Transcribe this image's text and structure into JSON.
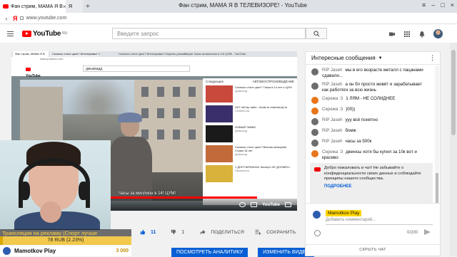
{
  "browser": {
    "tabs": [
      {
        "label": "Фан стрим, МАМА Я В"
      },
      {
        "label": "Я"
      }
    ],
    "window_title": "Фан стрим, МАМА Я В ТЕЛЕВИЗОРЕ! - YouTube",
    "url": "www.youtube.com"
  },
  "header": {
    "logo_text": "YouTube",
    "logo_region": "RU",
    "search_placeholder": "Введите запрос",
    "icons": [
      "video-camera-icon",
      "apps-grid-icon",
      "bell-icon",
      "avatar"
    ]
  },
  "embedded_stream": {
    "inner_tabs": [
      "Фан стрим, МАМА Я В",
      "Сколько стоит цикл? Инстаграмы! Секреты..."
    ],
    "inner_url": "www.youtube.com",
    "inner_title": "Сколько стоит цикл? Инстаграмы! Секреты раскайверат Часы за миллион в 14! ЦУМ! - YouTube",
    "inner_search": "дмыквадд",
    "next_label": "Следующее",
    "autoplay_label": "АВТОВОСПРОИЗВЕДЕНИЕ",
    "caption": "Часы за миллион в 14! ЦУМ!",
    "suggestions": [
      {
        "title": "Сколько стоит цикл? Тачка в 14 лет и ЦУМ",
        "meta": "Дымоход",
        "thumb": "#c9493c"
      },
      {
        "title": "24/7 lofi hip radio - beats to relax/study to",
        "meta": "ChilledCow",
        "thumb": "#3a2f6a"
      },
      {
        "title": "НОВЫЙ ЛИМИ!",
        "meta": "Дымоход",
        "thumb": "#1a1a1a"
      },
      {
        "title": "Сколько стоит цикл? Вечная женщина! Стрим 16 лет",
        "meta": "Дымоход",
        "thumb": "#c26a3a"
      },
      {
        "title": "1 ДНЯ ПАРКИНАЧ Эксперт НЕ ДОЛЖЕН...",
        "meta": "Прокатило",
        "thumb": "#d8b23a"
      }
    ],
    "progress": 0.86,
    "brand": "YouTube"
  },
  "overlay": {
    "title": "Трансляция на рекламу (Спорт лучше",
    "donation_text": "78 RUB (2.23%)",
    "donation_progress": 0.0223,
    "last_donor": "Mamotkov Play",
    "last_amount": "3 000"
  },
  "video_actions": {
    "likes": "11",
    "dislikes": "1",
    "share": "ПОДЕЛИТЬСЯ",
    "save": "СОХРАНИТЬ",
    "buttons": [
      "ПОСМОТРЕТЬ АНАЛИТИКУ",
      "ИЗМЕНИТЬ ВИДЕО"
    ]
  },
  "chat": {
    "header": "Интересные сообщения",
    "messages": [
      {
        "author": "RIP Jaseh",
        "text": "мы в его возрасте металл с пацанами сдавали...",
        "color": "#6d6d6d"
      },
      {
        "author": "RIP Jaseh",
        "text": "а он бл просто живёт и зарабатывает как работяги за всю жизнь",
        "color": "#6d6d6d"
      },
      {
        "author": "Сережа :3",
        "text": "1 ЛЯМ - НЕ СОЛИДНЕЕ",
        "color": "#e8751a"
      },
      {
        "author": "Сережа :3",
        "text": ")00))",
        "color": "#e8751a"
      },
      {
        "author": "RIP Jaseh",
        "text": "ууу всё понятно",
        "color": "#6d6d6d"
      },
      {
        "author": "RIP Jaseh",
        "text": "бомж",
        "color": "#6d6d6d"
      },
      {
        "author": "RIP Jaseh",
        "text": "часы за 500к",
        "color": "#6d6d6d"
      },
      {
        "author": "Сережа :3",
        "text": "джинсы хотя бы купил за 10к вот и красиво",
        "color": "#e8751a"
      }
    ],
    "system_note": "Добро пожаловать в чат! Не забывайте о конфиденциальности своих данных и соблюдайте принципы нашего сообщества.",
    "system_more": "ПОДРОБНЕЕ",
    "input_user": "Mamotkov Play",
    "input_placeholder": "Добавить комментарий...",
    "counter": "0/200",
    "hide": "СКРЫТЬ ЧАТ"
  }
}
